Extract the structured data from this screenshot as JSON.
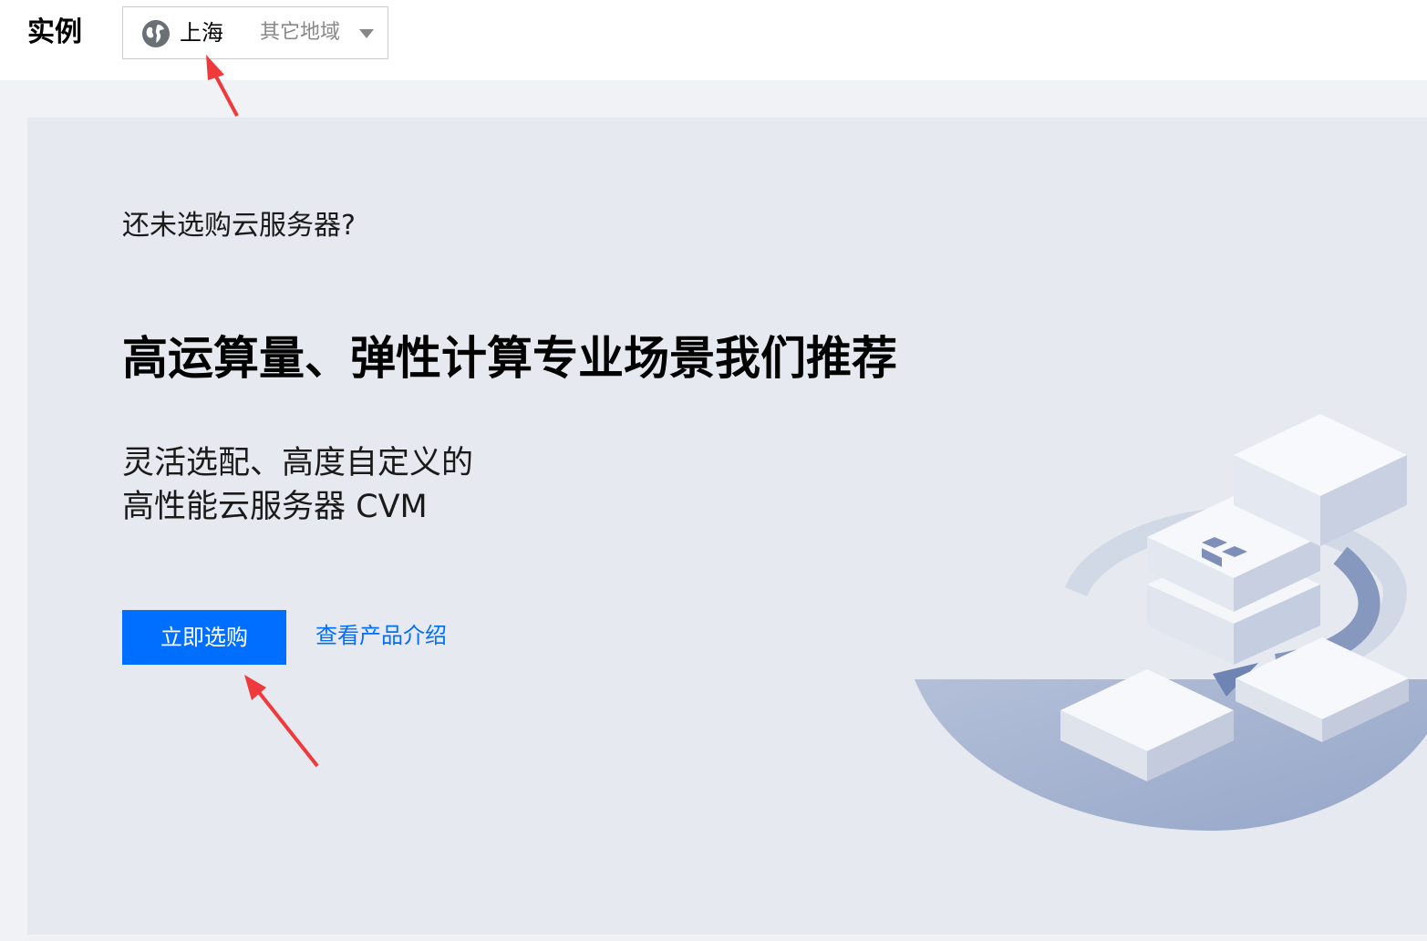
{
  "header": {
    "title": "实例",
    "region": {
      "icon": "globe-icon",
      "current": "上海",
      "other_label": "其它地域",
      "dropdown_icon": "chevron-down-icon"
    }
  },
  "empty_state": {
    "question": "还未选购云服务器?",
    "headline": "高运算量、弹性计算专业场景我们推荐",
    "description_line1": "灵活选配、高度自定义的",
    "description_line2": "高性能云服务器 CVM",
    "buy_button_label": "立即选购",
    "intro_link_label": "查看产品介绍"
  },
  "colors": {
    "accent": "#006eff",
    "panel_background": "#e6e9ef",
    "page_background": "#f0f2f5",
    "annotation_arrow": "#f0393a"
  }
}
